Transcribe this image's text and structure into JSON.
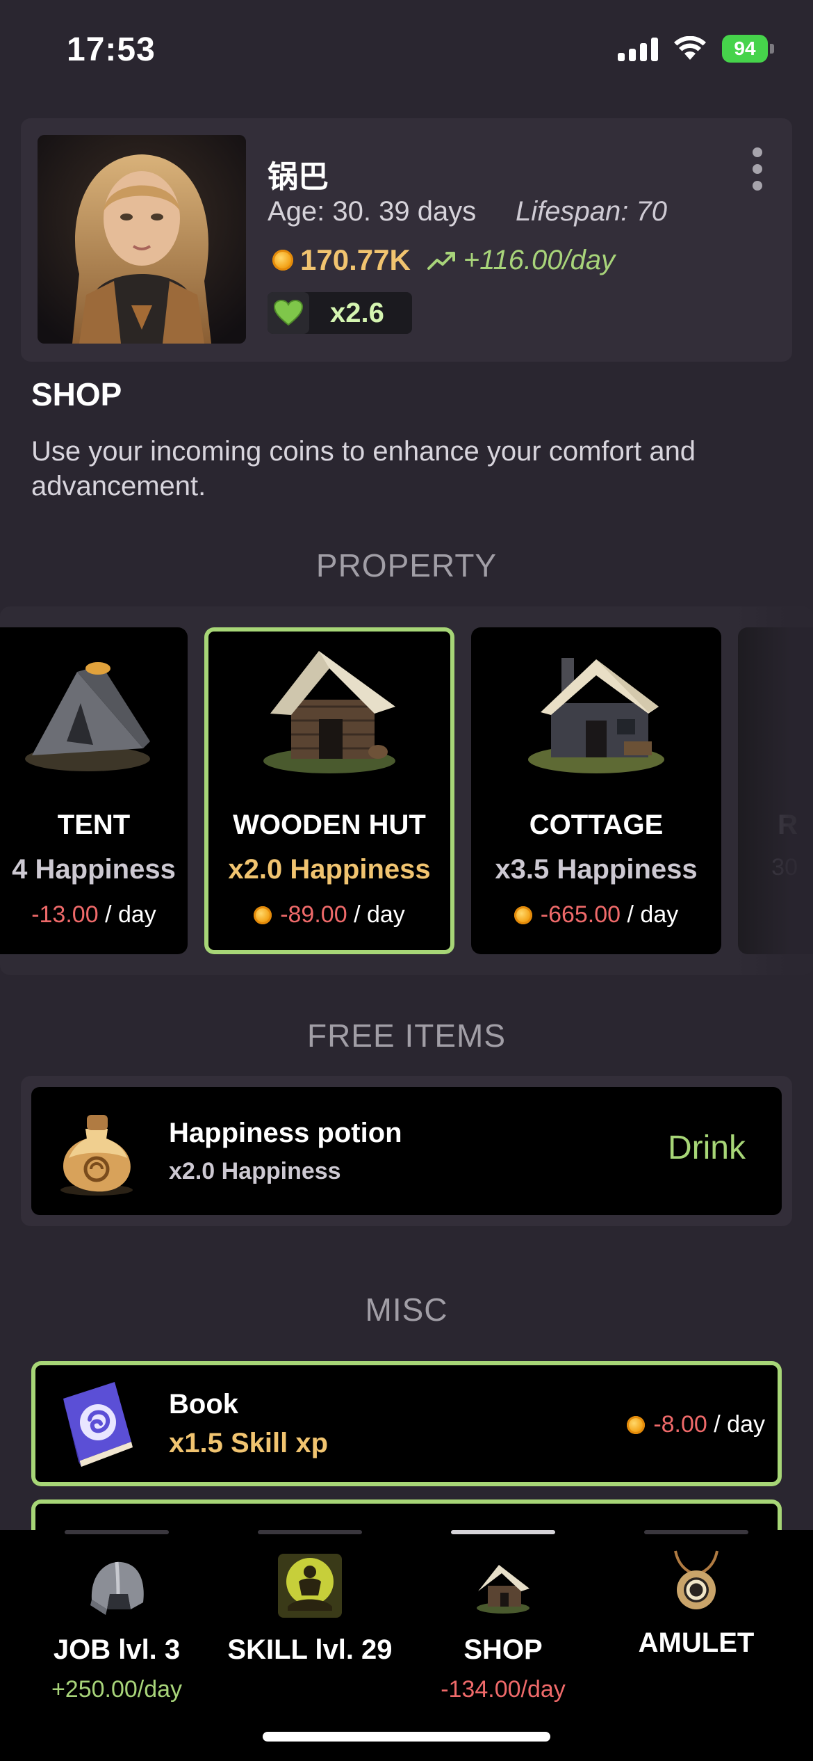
{
  "status_bar": {
    "time": "17:53",
    "battery": "94"
  },
  "profile": {
    "name": "锅巴",
    "age": "Age: 30. 39 days",
    "lifespan": "Lifespan: 70",
    "coins": "170.77K",
    "income": "+116.00/day",
    "happiness_multiplier": "x2.6"
  },
  "shop": {
    "title": "SHOP",
    "description": "Use your incoming coins to enhance your comfort and advancement."
  },
  "sections": {
    "property": "PROPERTY",
    "free_items": "FREE ITEMS",
    "misc": "MISC"
  },
  "properties": [
    {
      "name": "TENT",
      "happiness": "4 Happiness",
      "cost": "-13.00",
      "per": "/ day"
    },
    {
      "name": "WOODEN HUT",
      "happiness": "x2.0 Happiness",
      "cost": "-89.00",
      "per": "/ day"
    },
    {
      "name": "COTTAGE",
      "happiness": "x3.5 Happiness",
      "cost": "-665.00",
      "per": "/ day"
    },
    {
      "name": "R",
      "happiness": "30",
      "cost": "",
      "per": ""
    }
  ],
  "free_items": [
    {
      "title": "Happiness potion",
      "effect": "x2.0 Happiness",
      "action": "Drink"
    }
  ],
  "misc": [
    {
      "title": "Book",
      "effect": "x1.5 Skill xp",
      "cost": "-8.00",
      "per": "/ day"
    }
  ],
  "tabs": [
    {
      "label": "JOB lvl. 3",
      "sub": "+250.00/day"
    },
    {
      "label": "SKILL lvl. 29",
      "sub": ""
    },
    {
      "label": "SHOP",
      "sub": "-134.00/day"
    },
    {
      "label": "AMULET",
      "sub": ""
    }
  ],
  "colors": {
    "accent_green": "#a7d677",
    "gold": "#f1c470",
    "negative": "#ef6a6a"
  }
}
